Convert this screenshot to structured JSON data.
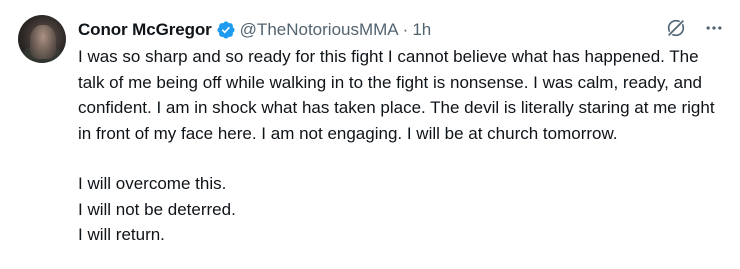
{
  "tweet": {
    "display_name": "Conor McGregor",
    "handle": "@TheNotoriousMMA",
    "separator": "·",
    "time": "1h",
    "paragraph_1": "I was so sharp and so ready for this fight I cannot believe what has happened. The talk of me being off while walking in to the fight is nonsense. I was calm, ready, and confident. I am in shock what has taken place. The devil is literally staring at me right in front of my face here. I am not engaging. I will be at church tomorrow.",
    "closing_lines": [
      "I will overcome this.",
      "I will not be deterred.",
      "I will return."
    ]
  },
  "icons": {
    "avatar": "avatar",
    "verified": "verified-badge-icon",
    "grok": "grok-icon",
    "more": "more-horizontal-icon"
  },
  "colors": {
    "text_primary": "#0f1419",
    "text_secondary": "#536471",
    "verified_blue": "#1d9bf0",
    "background": "#ffffff"
  }
}
